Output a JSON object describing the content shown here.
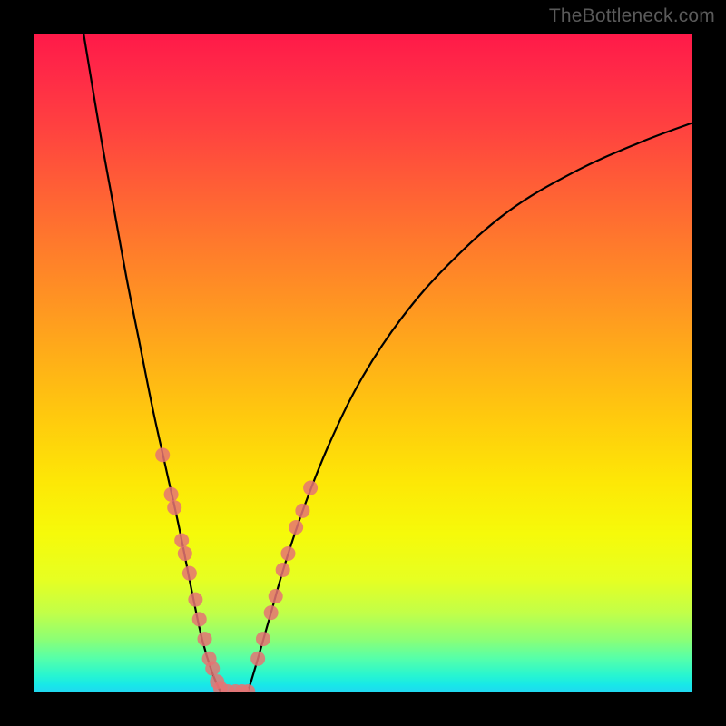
{
  "watermark": "TheBottleneck.com",
  "colors": {
    "curve_stroke": "#000000",
    "marker_fill": "#e57373",
    "marker_stroke": "rgba(0,0,0,0)"
  },
  "chart_data": {
    "type": "line",
    "title": "",
    "xlabel": "",
    "ylabel": "",
    "xlim": [
      0,
      100
    ],
    "ylim": [
      0,
      100
    ],
    "left_curve": {
      "x": [
        7.5,
        10,
        12,
        14,
        16,
        18,
        20,
        22,
        24,
        25.5,
        27,
        28.3
      ],
      "y": [
        100,
        85,
        74,
        63,
        53,
        43,
        34,
        25,
        15,
        8,
        3,
        0
      ]
    },
    "right_curve": {
      "x": [
        32.5,
        34,
        36,
        38,
        41,
        45,
        50,
        56,
        63,
        72,
        82,
        92,
        100
      ],
      "y": [
        0,
        5,
        12,
        19,
        28,
        38,
        48,
        57,
        65,
        73,
        79,
        83.5,
        86.5
      ]
    },
    "flat_segment": {
      "x": [
        28.3,
        32.5
      ],
      "y": [
        0,
        0
      ]
    },
    "series": [
      {
        "name": "left-markers",
        "x": [
          19.5,
          20.8,
          21.3,
          22.4,
          22.9,
          23.6,
          24.5,
          25.1,
          25.9,
          26.6,
          27.1,
          27.8,
          28.3,
          29.4,
          30.6,
          31.6,
          32.5
        ],
        "y": [
          36,
          30,
          28,
          23,
          21,
          18,
          14,
          11,
          8,
          5,
          3.5,
          1.5,
          0.5,
          0,
          0,
          0,
          0
        ]
      },
      {
        "name": "right-markers",
        "x": [
          34.0,
          34.8,
          36.0,
          36.7,
          37.8,
          38.6,
          39.8,
          40.8,
          42.0
        ],
        "y": [
          5,
          8,
          12,
          14.5,
          18.5,
          21,
          25,
          27.5,
          31
        ]
      }
    ]
  }
}
